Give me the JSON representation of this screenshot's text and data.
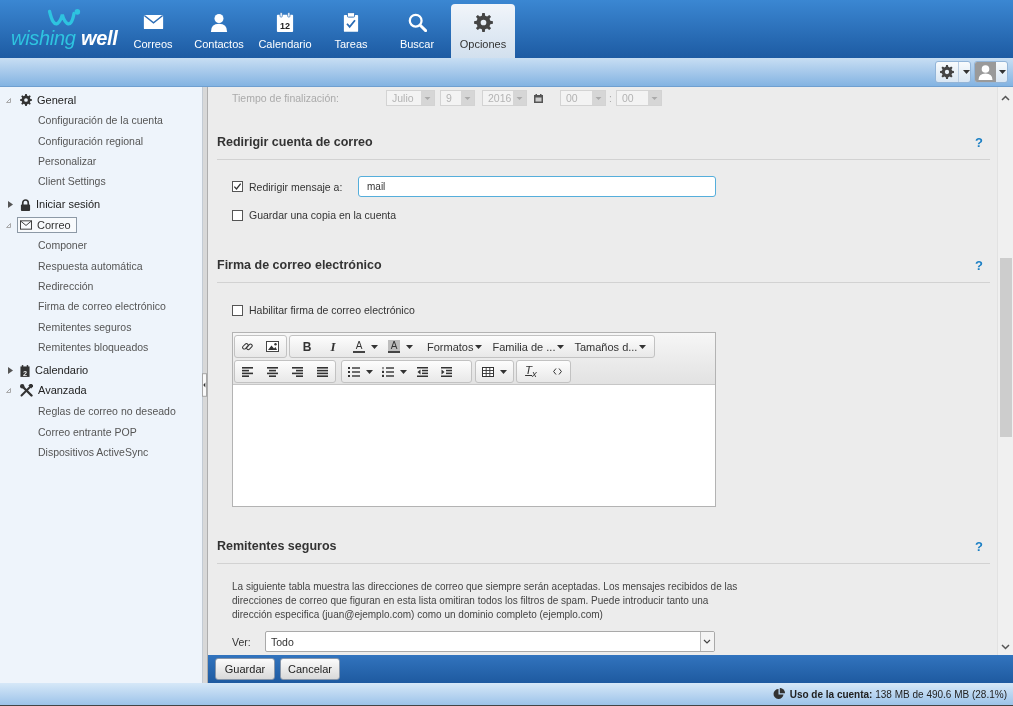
{
  "header": {
    "logo": {
      "text_1": "wishing",
      "text_2": "well"
    },
    "nav_tabs": [
      {
        "label": "Correos",
        "selected": false
      },
      {
        "label": "Contactos",
        "selected": false
      },
      {
        "label": "Calendario",
        "selected": false,
        "icon_text": "12"
      },
      {
        "label": "Tareas",
        "selected": false
      },
      {
        "label": "Buscar",
        "selected": false
      },
      {
        "label": "Opciones",
        "selected": true
      }
    ]
  },
  "sidebar": {
    "tree": [
      {
        "label": "General",
        "expanded": true,
        "selected": false,
        "children": [
          {
            "label": "Configuración de la cuenta",
            "selected": false
          },
          {
            "label": "Configuración regional",
            "selected": false
          },
          {
            "label": "Personalizar",
            "selected": false
          },
          {
            "label": "Client Settings",
            "selected": false
          }
        ]
      },
      {
        "label": "Iniciar sesión",
        "expanded": false,
        "selected": false
      },
      {
        "label": "Correo",
        "expanded": true,
        "selected": true,
        "children": [
          {
            "label": "Componer",
            "selected": false
          },
          {
            "label": "Respuesta automática",
            "selected": false
          },
          {
            "label": "Redirección",
            "selected": false
          },
          {
            "label": "Firma de correo electrónico",
            "selected": false
          },
          {
            "label": "Remitentes seguros",
            "selected": false
          },
          {
            "label": "Remitentes bloqueados",
            "selected": false
          }
        ]
      },
      {
        "label": "Calendario",
        "expanded": false,
        "selected": false,
        "icon_text": "2"
      },
      {
        "label": "Avanzada",
        "expanded": true,
        "selected": false,
        "children": [
          {
            "label": "Reglas de correo no deseado",
            "selected": false
          },
          {
            "label": "Correo entrante POP",
            "selected": false
          },
          {
            "label": "Dispositivos ActiveSync",
            "selected": false
          }
        ]
      }
    ]
  },
  "end_time_row": {
    "label": "Tiempo de finalización:",
    "disabled": true,
    "month": "Julio",
    "day": "9",
    "year": "2016",
    "hour": "00",
    "separator": ":",
    "minute": "00"
  },
  "redirect_section": {
    "title": "Redirigir cuenta de correo",
    "help": "?",
    "forward_option": {
      "label": "Redirigir mensaje a:",
      "checked": true,
      "value": "mail"
    },
    "keep_copy_option": {
      "label": "Guardar una copia en la cuenta",
      "checked": false
    }
  },
  "signature_section": {
    "title": "Firma de correo electrónico",
    "help": "?",
    "enable_option": {
      "label": "Habilitar firma de correo electrónico",
      "checked": false
    },
    "editor_toolbar": {
      "bold": "B",
      "italic": "I",
      "text_color": "A",
      "background_color": "A",
      "dropdowns": [
        "Formatos",
        "Familia de ...",
        "Tamaños d..."
      ],
      "clear_format": "T$_{x}$"
    }
  },
  "safe_senders_section": {
    "title": "Remitentes seguros",
    "help": "?",
    "description": "La siguiente tabla muestra las direcciones de correo que siempre serán aceptadas. Los mensajes recibidos de las direcciones de correo que figuran en esta lista omitiran todos los filtros de spam. Puede introducir tanto una dirección especifica (juan@ejemplo.com) como un dominio completo (ejemplo.com)",
    "view_filter": {
      "label": "Ver:",
      "value": "Todo"
    }
  },
  "footer_buttons": [
    {
      "label": "Guardar"
    },
    {
      "label": "Cancelar"
    }
  ],
  "status_bar": {
    "usage": "**Uso de la cuenta:** 138 MB de 490.6 MB (28.1%)"
  }
}
